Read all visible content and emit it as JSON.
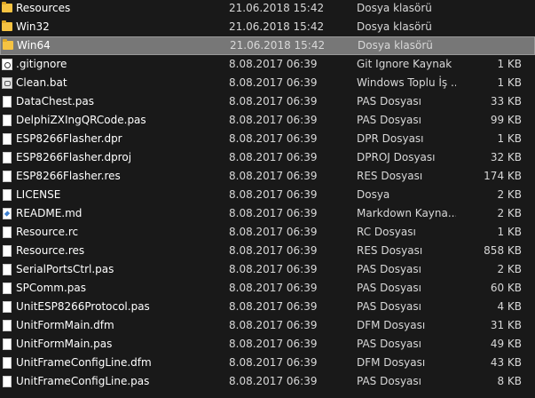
{
  "files": [
    {
      "icon": "folder-icon",
      "name": "Resources",
      "date": "21.06.2018 15:42",
      "type": "Dosya klasörü",
      "size": ""
    },
    {
      "icon": "folder-icon",
      "name": "Win32",
      "date": "21.06.2018 15:42",
      "type": "Dosya klasörü",
      "size": ""
    },
    {
      "icon": "folder-icon",
      "name": "Win64",
      "date": "21.06.2018 15:42",
      "type": "Dosya klasörü",
      "size": "",
      "selected": true
    },
    {
      "icon": "config-file-icon",
      "name": ".gitignore",
      "date": "8.08.2017 06:39",
      "type": "Git Ignore Kaynak ...",
      "size": "1 KB"
    },
    {
      "icon": "batch-file-icon",
      "name": "Clean.bat",
      "date": "8.08.2017 06:39",
      "type": "Windows Toplu İş ...",
      "size": "1 KB"
    },
    {
      "icon": "file-icon",
      "name": "DataChest.pas",
      "date": "8.08.2017 06:39",
      "type": "PAS Dosyası",
      "size": "33 KB"
    },
    {
      "icon": "file-icon",
      "name": "DelphiZXIngQRCode.pas",
      "date": "8.08.2017 06:39",
      "type": "PAS Dosyası",
      "size": "99 KB"
    },
    {
      "icon": "file-icon",
      "name": "ESP8266Flasher.dpr",
      "date": "8.08.2017 06:39",
      "type": "DPR Dosyası",
      "size": "1 KB"
    },
    {
      "icon": "file-icon",
      "name": "ESP8266Flasher.dproj",
      "date": "8.08.2017 06:39",
      "type": "DPROJ Dosyası",
      "size": "32 KB"
    },
    {
      "icon": "file-icon",
      "name": "ESP8266Flasher.res",
      "date": "8.08.2017 06:39",
      "type": "RES Dosyası",
      "size": "174 KB"
    },
    {
      "icon": "file-icon",
      "name": "LICENSE",
      "date": "8.08.2017 06:39",
      "type": "Dosya",
      "size": "2 KB"
    },
    {
      "icon": "markdown-file-icon",
      "name": "README.md",
      "date": "8.08.2017 06:39",
      "type": "Markdown Kayna...",
      "size": "2 KB"
    },
    {
      "icon": "file-icon",
      "name": "Resource.rc",
      "date": "8.08.2017 06:39",
      "type": "RC Dosyası",
      "size": "1 KB"
    },
    {
      "icon": "file-icon",
      "name": "Resource.res",
      "date": "8.08.2017 06:39",
      "type": "RES Dosyası",
      "size": "858 KB"
    },
    {
      "icon": "file-icon",
      "name": "SerialPortsCtrl.pas",
      "date": "8.08.2017 06:39",
      "type": "PAS Dosyası",
      "size": "2 KB"
    },
    {
      "icon": "file-icon",
      "name": "SPComm.pas",
      "date": "8.08.2017 06:39",
      "type": "PAS Dosyası",
      "size": "60 KB"
    },
    {
      "icon": "file-icon",
      "name": "UnitESP8266Protocol.pas",
      "date": "8.08.2017 06:39",
      "type": "PAS Dosyası",
      "size": "4 KB"
    },
    {
      "icon": "file-icon",
      "name": "UnitFormMain.dfm",
      "date": "8.08.2017 06:39",
      "type": "DFM Dosyası",
      "size": "31 KB"
    },
    {
      "icon": "file-icon",
      "name": "UnitFormMain.pas",
      "date": "8.08.2017 06:39",
      "type": "PAS Dosyası",
      "size": "49 KB"
    },
    {
      "icon": "file-icon",
      "name": "UnitFrameConfigLine.dfm",
      "date": "8.08.2017 06:39",
      "type": "DFM Dosyası",
      "size": "43 KB"
    },
    {
      "icon": "file-icon",
      "name": "UnitFrameConfigLine.pas",
      "date": "8.08.2017 06:39",
      "type": "PAS Dosyası",
      "size": "8 KB"
    }
  ],
  "colors": {
    "background": "#191919",
    "selection": "#777777",
    "folder": "#f6c342"
  }
}
